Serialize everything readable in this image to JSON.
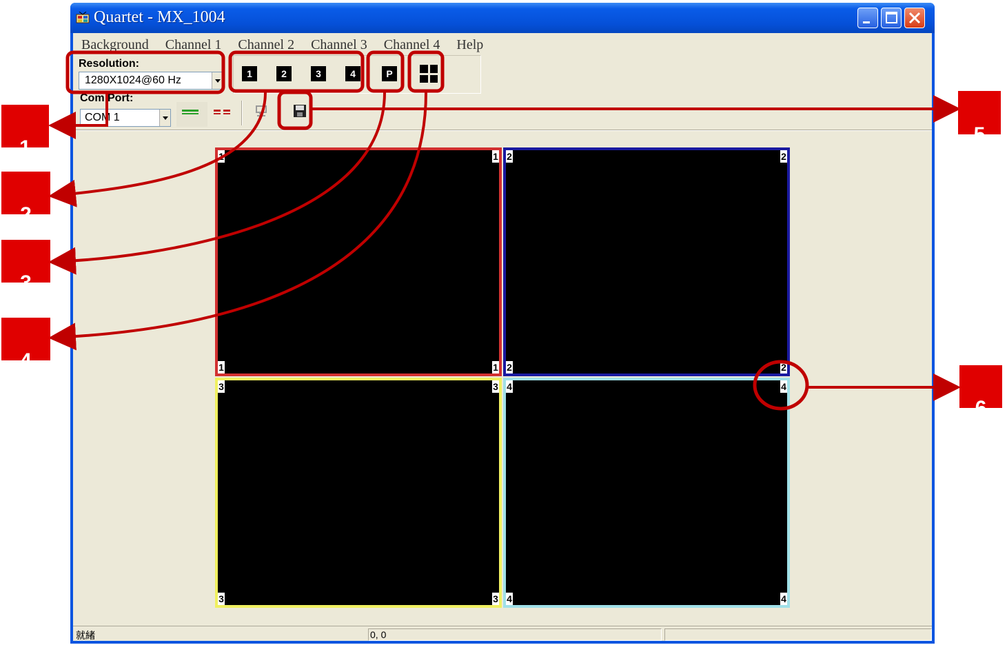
{
  "window": {
    "title": "Quartet - MX_1004"
  },
  "menu": [
    "Background",
    "Channel 1",
    "Channel 2",
    "Channel 3",
    "Channel 4",
    "Help"
  ],
  "resolution": {
    "label": "Resolution:",
    "value": "1280X1024@60 Hz"
  },
  "channel_buttons": [
    "1",
    "2",
    "3",
    "4"
  ],
  "pip_button": "P",
  "com": {
    "label": "Com Port:",
    "value": "COM 1"
  },
  "panels": [
    {
      "number": "1",
      "color": "#d23030"
    },
    {
      "number": "2",
      "color": "#1a1aa0"
    },
    {
      "number": "3",
      "color": "#f0f060"
    },
    {
      "number": "4",
      "color": "#a0e0e8"
    }
  ],
  "status": {
    "ready": "就緒",
    "coords": "0, 0"
  },
  "annotations": {
    "color": "#c00000",
    "callouts": [
      "1",
      "2",
      "3",
      "4",
      "5",
      "6"
    ]
  }
}
